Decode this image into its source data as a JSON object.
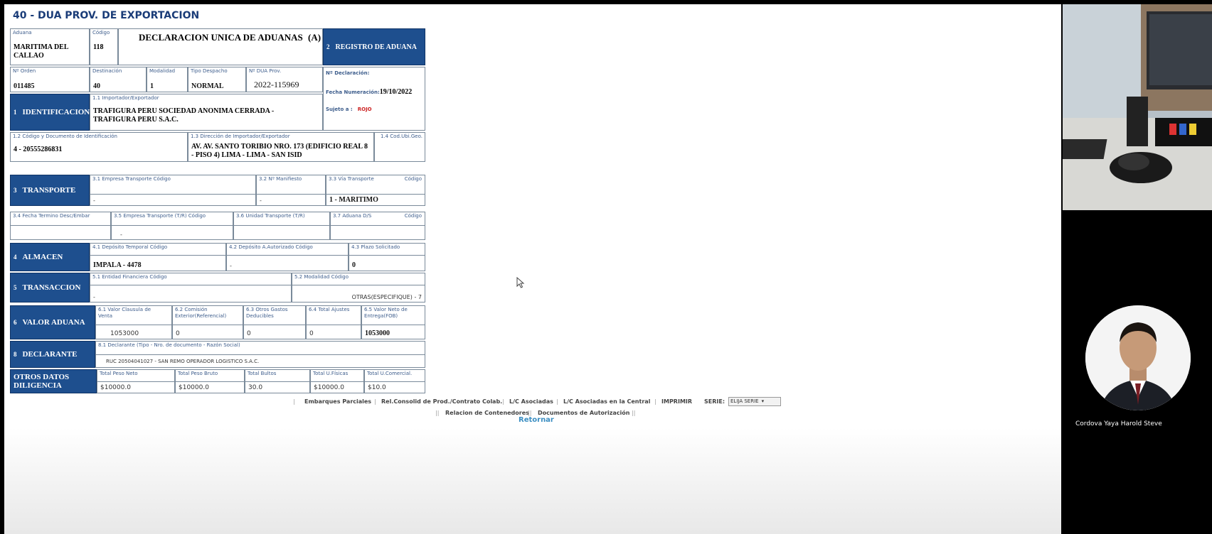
{
  "page_title": "40 - DUA PROV. DE EXPORTACION",
  "header": {
    "aduana_label": "Aduana",
    "aduana_value": "MARITIMA DEL CALLAO",
    "codigo_label": "Código",
    "codigo_value": "118",
    "form_title": "DECLARACION UNICA DE ADUANAS",
    "form_title_suffix": "(A)",
    "registro_num": "2",
    "registro_label": "REGISTRO DE ADUANA"
  },
  "row2": {
    "orden_label": "Nº Orden",
    "orden_value": "011485",
    "destinacion_label": "Destinación",
    "destinacion_value": "40",
    "modalidad_label": "Modalidad",
    "modalidad_value": "1",
    "tipo_despacho_label": "Tipo Despacho",
    "tipo_despacho_value": "NORMAL",
    "dua_prov_label": "Nº DUA Prov.",
    "dua_prov_value": "2022-115969",
    "declaracion_label": "Nº Declaración:",
    "fecha_label": "Fecha Numeración:",
    "fecha_value": "19/10/2022",
    "sujeto_label": "Sujeto a :",
    "sujeto_value": "ROJO"
  },
  "identificacion": {
    "num": "1",
    "title": "IDENTIFICACION",
    "importador_label": "1.1 Importador/Exportador",
    "importador_value_1": "TRAFIGURA PERU SOCIEDAD ANONIMA CERRADA -",
    "importador_value_2": "TRAFIGURA PERU S.A.C.",
    "doc_label": "1.2 Código y Documento de Identificación",
    "doc_value": "4 - 20555286831",
    "direccion_label": "1.3 Dirección de Importador/Exportador",
    "direccion_value_1": "AV. AV. SANTO TORIBIO NRO. 173 (EDIFICIO REAL 8",
    "direccion_value_2": "- PISO 4) LIMA - LIMA - SAN ISID",
    "ubigeo_label": "1.4 Cod.Ubi.Geo."
  },
  "transporte": {
    "num": "3",
    "title": "TRANSPORTE",
    "empresa_label": "3.1 Empresa Transporte Código",
    "empresa_value": "-",
    "manifiesto_label": "3.2 Nº Manifiesto",
    "manifiesto_value": "-",
    "via_label": "3.3 Vía Transporte",
    "via_codigo_label": "Código",
    "via_value": "1 - MARITIMO",
    "fecha_termino_label": "3.4 Fecha Termino Desc/Embar",
    "empresa_tr_label": "3.5 Empresa Transporte (T/R)  Código",
    "empresa_tr_value": "-",
    "unidad_tr_label": "3.6 Unidad Transporte (T/R)",
    "aduana_ds_label": "3.7 Aduana D/S",
    "aduana_ds_codigo_label": "Código"
  },
  "almacen": {
    "num": "4",
    "title": "ALMACEN",
    "deposito_temp_label": "4.1 Depósito Temporal  Código",
    "deposito_temp_value": "IMPALA - 4478",
    "deposito_aut_label": "4.2 Depósito A.Autorizado Código",
    "deposito_aut_value": "-",
    "plazo_label": "4.3 Plazo Solicitado",
    "plazo_value": "0"
  },
  "transaccion": {
    "num": "5",
    "title": "TRANSACCION",
    "entidad_label": "5.1 Entidad Financiera    Código",
    "entidad_value": "-",
    "modalidad_label": "5.2 Modalidad   Código",
    "modalidad_value": "OTRAS(ESPECIFIQUE) - 7"
  },
  "valor_aduana": {
    "num": "6",
    "title": "VALOR ADUANA",
    "clausula_label_1": "6.1 Valor Clausula de",
    "clausula_label_2": "Venta",
    "clausula_value": "1053000",
    "comision_label_1": "6.2 Comisión",
    "comision_label_2": "Exterior(Referencial)",
    "comision_value": "0",
    "otros_label_1": "6.3 Otros Gastos",
    "otros_label_2": "Deducibles",
    "otros_value": "0",
    "ajustes_label": "6.4 Total Ajustes",
    "ajustes_value": "0",
    "neto_label_1": "6.5 Valor Neto de",
    "neto_label_2": "Entrega(FOB)",
    "neto_value": "1053000"
  },
  "declarante": {
    "num": "8",
    "title": "DECLARANTE",
    "label": "8.1 Declarante (Tipo - Nro. de documento - Razón Social)",
    "value": "RUC 20504041027 - SAN REMO OPERADOR LOGISTICO S.A.C."
  },
  "otros_datos": {
    "title_1": "OTROS DATOS",
    "title_2": "DILIGENCIA",
    "peso_neto_label": "Total Peso Neto",
    "peso_neto_value": "$10000.0",
    "peso_bruto_label": "Total Peso Bruto",
    "peso_bruto_value": "$10000.0",
    "bultos_label": "Total Bultos",
    "bultos_value": "30.0",
    "u_fisicas_label": "Total U.Físicas",
    "u_fisicas_value": "$10000.0",
    "u_comercial_label": "Total U.Comercial.",
    "u_comercial_value": "$10.0"
  },
  "links": {
    "embarques": "Embarques Parciales",
    "relconsolid": "Rel.Consolid de Prod./Contrato Colab.",
    "lc_asociadas": "L/C Asociadas",
    "lc_central": "L/C Asociadas en la Central",
    "imprimir": "IMPRIMIR",
    "serie_label": "SERIE:",
    "serie_select": "ELIJA SERIE",
    "contenedores": "Relacion de Contenedores",
    "autorizacion": "Documentos de Autorización",
    "retornar": "Retornar"
  },
  "meeting": {
    "participant_name": "Cordova Yaya Harold Steve"
  },
  "colors": {
    "section_blue": "#1e4f8e",
    "title_blue": "#1a3c78",
    "sujeto_red": "#cc2222",
    "link_blue": "#3b8ec2"
  }
}
